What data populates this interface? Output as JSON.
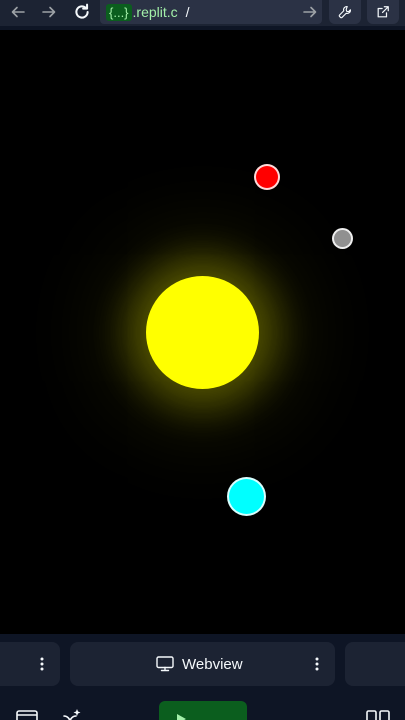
{
  "browser_bar": {
    "url_badge": "{...}",
    "url_host": ".replit.c",
    "url_path": "/"
  },
  "scene": {
    "sun_color": "#ffff00",
    "planets": [
      {
        "name": "red-planet",
        "color": "#ff0000"
      },
      {
        "name": "grey-planet",
        "color": "#909090"
      },
      {
        "name": "cyan-planet",
        "color": "#00ffff"
      }
    ],
    "background": "#000000"
  },
  "tabs": {
    "active_label": "Webview"
  },
  "colors": {
    "chrome_bg": "#0e1525",
    "bar_bg": "#1c2333",
    "url_accent": "#a3f0a9",
    "run_green": "#0b5e1e"
  }
}
